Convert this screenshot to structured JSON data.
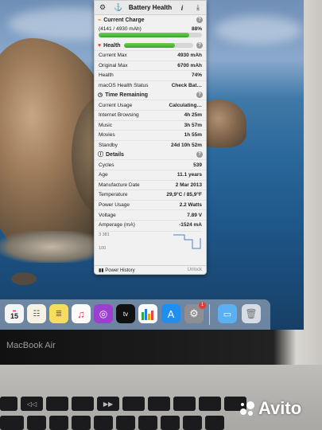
{
  "panel": {
    "title": "Battery Health",
    "current_charge": {
      "label": "Current Charge",
      "detail": "(4141 / 4930 mAh)",
      "percent_text": "88%",
      "fraction": 0.88
    },
    "health": {
      "label": "Health",
      "fraction": 0.74,
      "rows": [
        {
          "label": "Current Max",
          "value": "4930 mAh"
        },
        {
          "label": "Original Max",
          "value": "6700 mAh"
        },
        {
          "label": "Health",
          "value": "74%"
        },
        {
          "label": "macOS Health Status",
          "value": "Check Bat…"
        }
      ]
    },
    "time_remaining": {
      "label": "Time Remaining",
      "rows": [
        {
          "label": "Current Usage",
          "value": "Calculating…"
        },
        {
          "label": "Internet Browsing",
          "value": "4h 25m"
        },
        {
          "label": "Music",
          "value": "3h 57m"
        },
        {
          "label": "Movies",
          "value": "1h 55m"
        },
        {
          "label": "Standby",
          "value": "24d 10h 52m"
        }
      ]
    },
    "details": {
      "label": "Details",
      "rows": [
        {
          "label": "Cycles",
          "value": "539"
        },
        {
          "label": "Age",
          "value": "11.1 years"
        },
        {
          "label": "Manufacture Date",
          "value": "2 Mar 2013"
        },
        {
          "label": "Temperature",
          "value": "29,9°C / 85,9°F"
        },
        {
          "label": "Power Usage",
          "value": "2.2 Watts"
        },
        {
          "label": "Voltage",
          "value": "7.89 V"
        },
        {
          "label": "Amperage (mA)",
          "value": "-1524 mA"
        }
      ]
    },
    "graph": {
      "top_label": "3 381",
      "bottom_label": "100"
    },
    "footer": {
      "left": "Power History",
      "right": "Unlock"
    }
  },
  "dock": {
    "calendar_day": "15",
    "badge_count": "1"
  },
  "laptop_brand": "MacBook Air",
  "watermark": "Avito",
  "colors": {
    "bar_green": "#3aa42c",
    "heart_red": "#e53935",
    "charge_orange": "#e08a1e"
  }
}
